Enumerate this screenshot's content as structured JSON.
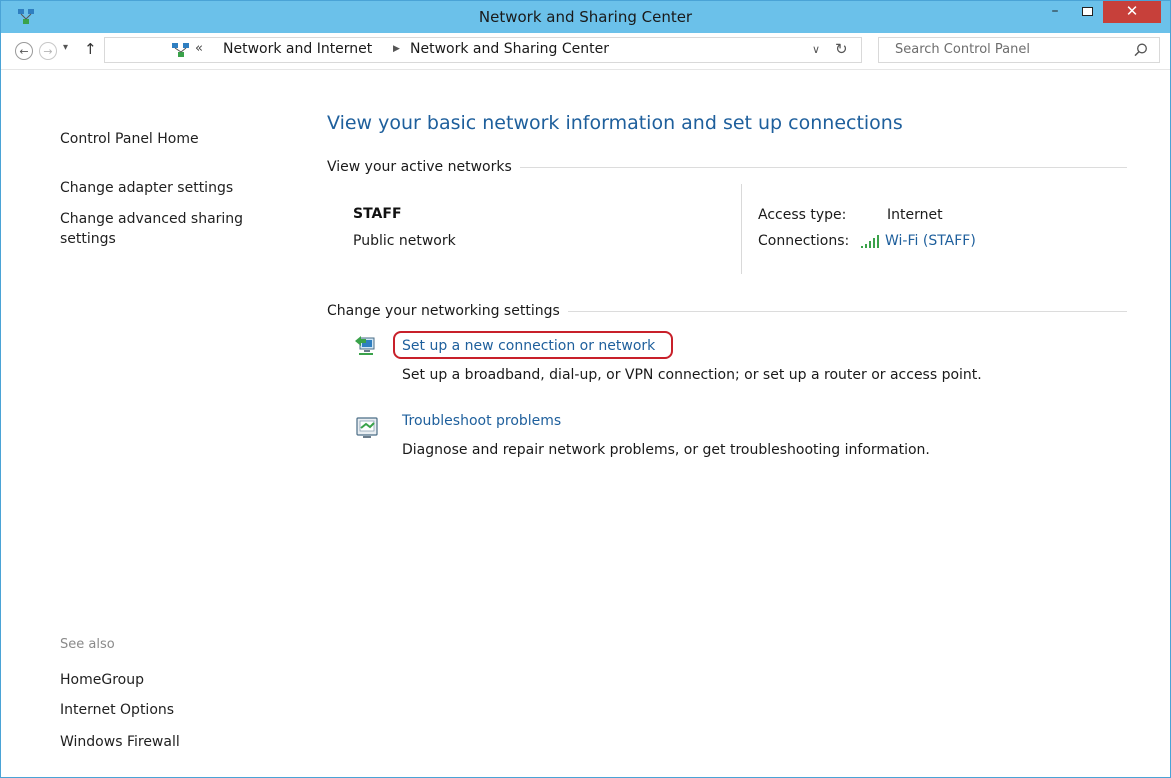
{
  "window": {
    "title": "Network and Sharing Center",
    "minimize_glyph": "–",
    "close_glyph": "✕"
  },
  "nav": {
    "back_glyph": "←",
    "forward_glyph": "→",
    "recent_glyph": "▾",
    "up_glyph": "↑",
    "address_separator": "«",
    "breadcrumbs": [
      "Network and Internet",
      "Network and Sharing Center"
    ],
    "crumb_arrow": "▶",
    "dropdown_glyph": "∨",
    "refresh_glyph": "↻",
    "search_placeholder": "Search Control Panel"
  },
  "sidebar": {
    "home": "Control Panel Home",
    "links": [
      "Change adapter settings",
      "Change advanced sharing settings"
    ],
    "see_also_title": "See also",
    "see_also": [
      "HomeGroup",
      "Internet Options",
      "Windows Firewall"
    ]
  },
  "main": {
    "title": "View your basic network information and set up connections",
    "active_networks_header": "View your active networks",
    "network": {
      "name": "STAFF",
      "type": "Public network",
      "access_label": "Access type:",
      "access_value": "Internet",
      "connections_label": "Connections:",
      "connections_value": "Wi-Fi (STAFF)"
    },
    "settings_header": "Change your networking settings",
    "tasks": [
      {
        "link": "Set up a new connection or network",
        "desc": "Set up a broadband, dial-up, or VPN connection; or set up a router or access point."
      },
      {
        "link": "Troubleshoot problems",
        "desc": "Diagnose and repair network problems, or get troubleshooting information."
      }
    ]
  },
  "colors": {
    "titlebar": "#6bc1ea",
    "link": "#1e5f9c",
    "close_button": "#c7403a",
    "highlight": "#c8202a"
  },
  "icons": {
    "app": "network-center-icon",
    "search": "search-icon",
    "wifi": "wifi-signal-icon",
    "new_connection": "new-connection-icon",
    "troubleshoot": "troubleshoot-icon"
  }
}
